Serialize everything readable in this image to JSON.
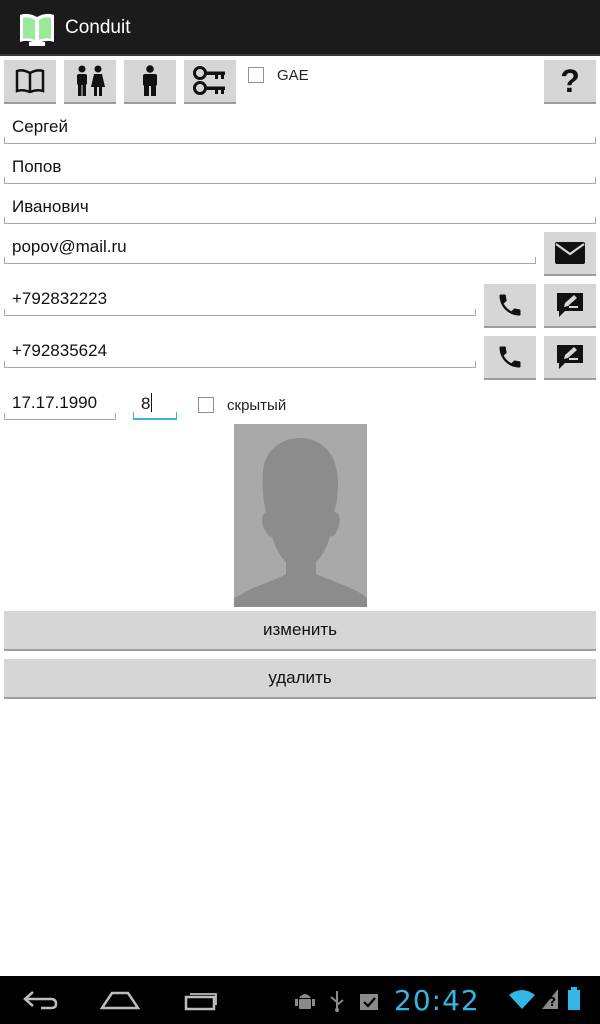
{
  "app": {
    "title": "Conduit",
    "icon": "book-icon"
  },
  "toolbar": {
    "buttons": [
      {
        "name": "book-button",
        "icon": "book-icon"
      },
      {
        "name": "couple-button",
        "icon": "people-icon"
      },
      {
        "name": "person-button",
        "icon": "person-icon"
      },
      {
        "name": "keys-button",
        "icon": "keys-icon"
      }
    ],
    "gae_label": "GAE",
    "gae_checked": false,
    "help_label": "?"
  },
  "form": {
    "first_name": "Сергей",
    "last_name": "Попов",
    "middle_name": "Иванович",
    "email": "popov@mail.ru",
    "phone1": "+792832223",
    "phone2": "+792835624",
    "birth_date": "17.17.1990",
    "number": "8",
    "hidden_label": "скрытый",
    "hidden_checked": false
  },
  "photo": {
    "icon": "person-silhouette-icon"
  },
  "actions": {
    "edit_label": "изменить",
    "delete_label": "удалить"
  },
  "statusbar": {
    "time": "20:42",
    "accent_color": "#33b5e5"
  }
}
